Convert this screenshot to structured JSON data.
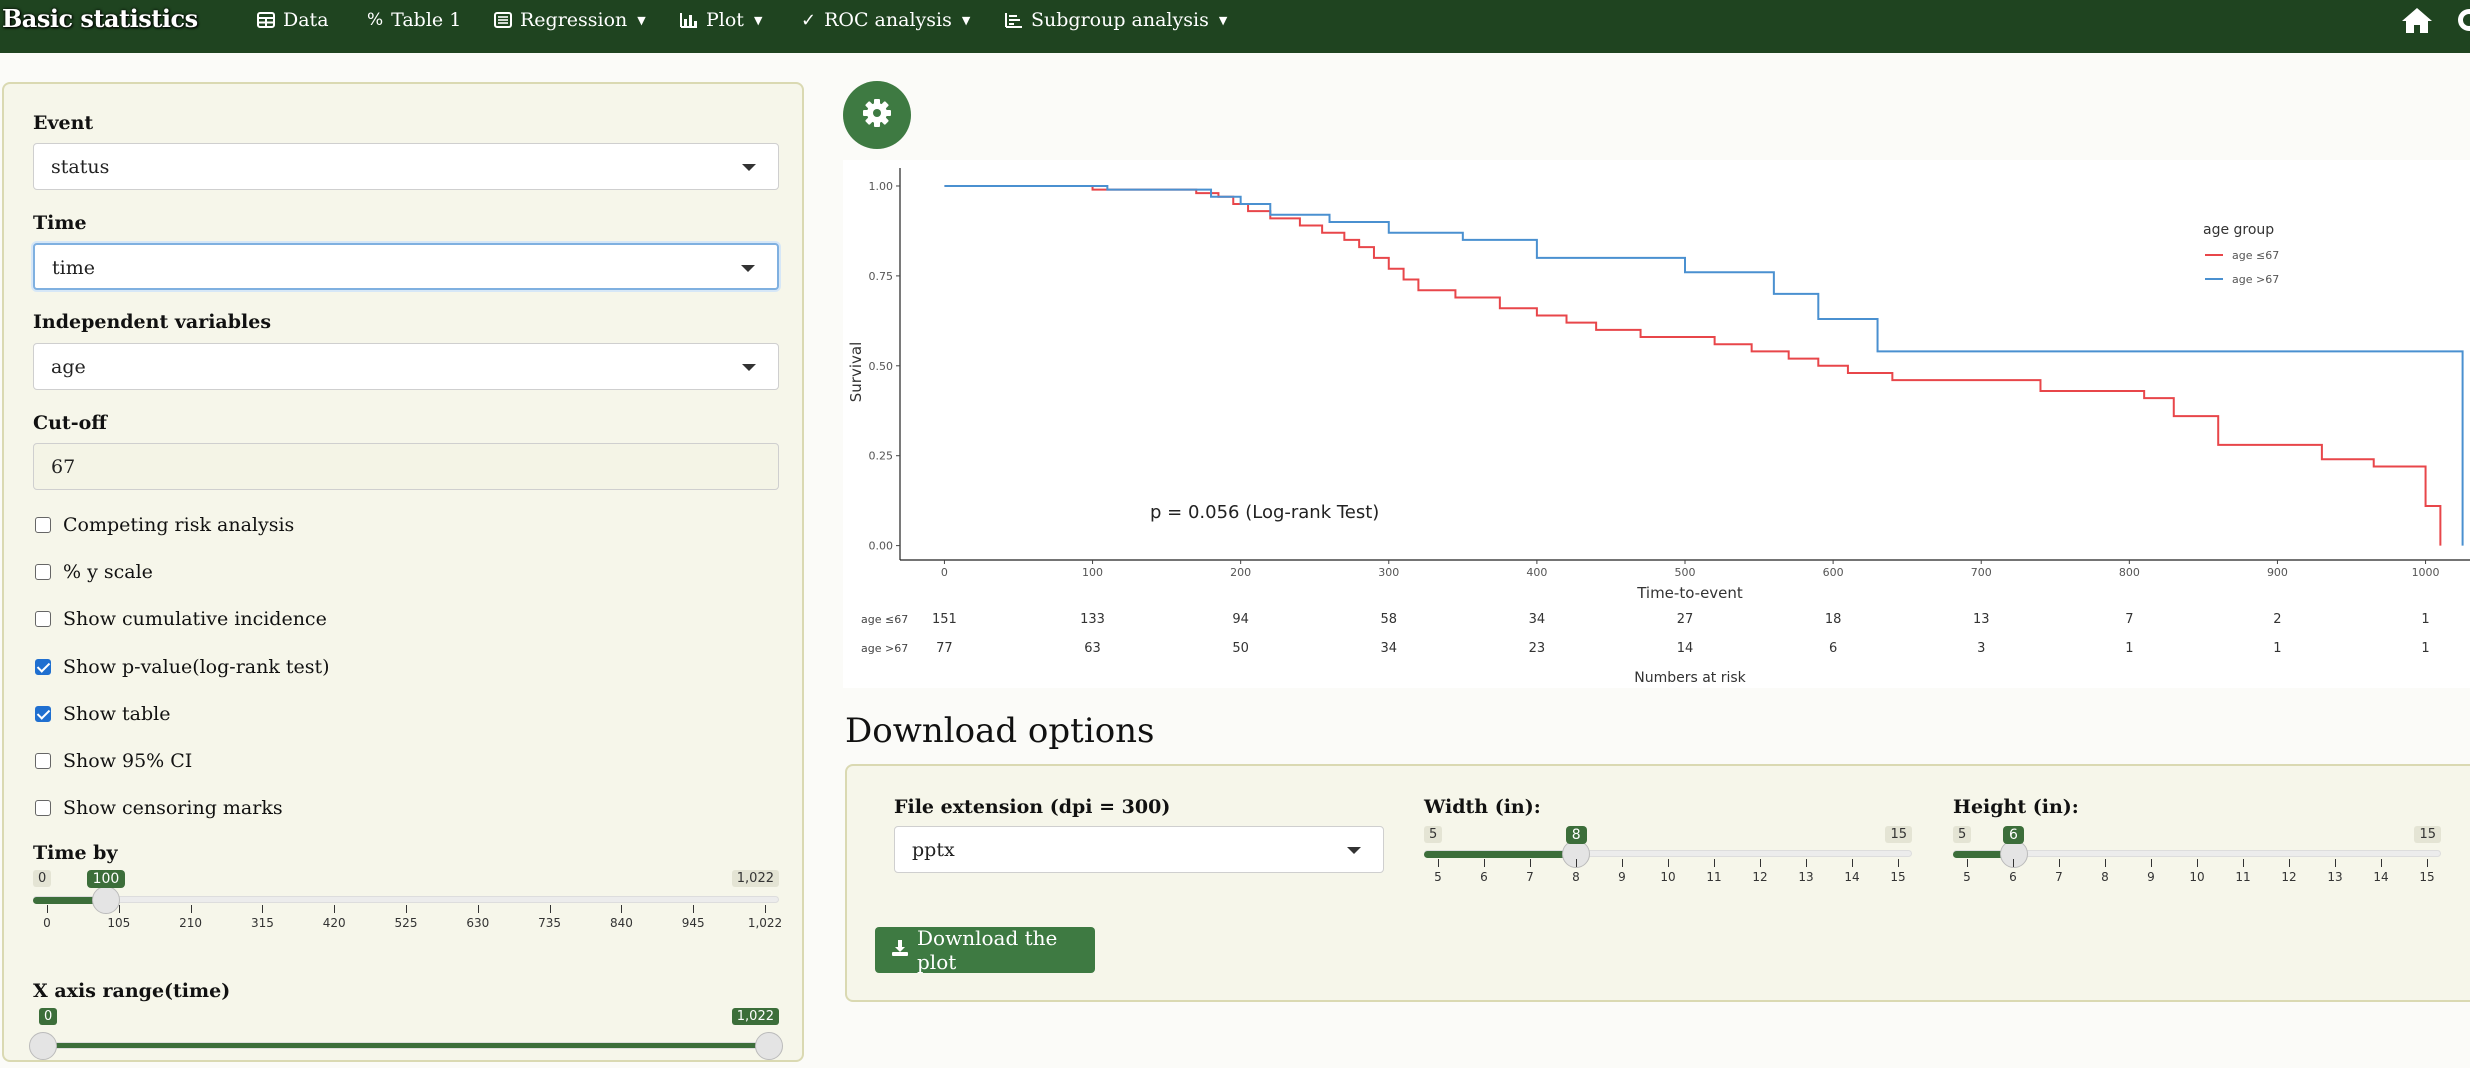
{
  "navbar": {
    "brand": "Basic statistics",
    "items": [
      {
        "label": "Data",
        "icon": "table-icon",
        "dropdown": false
      },
      {
        "label": "Table 1",
        "icon": "percent-icon",
        "dropdown": false
      },
      {
        "label": "Regression",
        "icon": "list-alt-icon",
        "dropdown": true
      },
      {
        "label": "Plot",
        "icon": "bar-chart-icon",
        "dropdown": true
      },
      {
        "label": "ROC analysis",
        "icon": "check-icon",
        "dropdown": true
      },
      {
        "label": "Subgroup analysis",
        "icon": "line-chart-icon",
        "dropdown": true
      }
    ]
  },
  "sidebar": {
    "event": {
      "label": "Event",
      "value": "status"
    },
    "time": {
      "label": "Time",
      "value": "time"
    },
    "indep": {
      "label": "Independent variables",
      "value": "age"
    },
    "cutoff": {
      "label": "Cut-off",
      "value": "67"
    },
    "checkboxes": [
      {
        "label": "Competing risk analysis",
        "checked": false
      },
      {
        "label": "% y scale",
        "checked": false
      },
      {
        "label": "Show cumulative incidence",
        "checked": false
      },
      {
        "label": "Show p-value(log-rank test)",
        "checked": true
      },
      {
        "label": "Show table",
        "checked": true
      },
      {
        "label": "Show 95% CI",
        "checked": false
      },
      {
        "label": "Show censoring marks",
        "checked": false
      }
    ],
    "time_by": {
      "label": "Time by",
      "min": "0",
      "max": "1,022",
      "value": "100",
      "value_fraction": 0.098,
      "ticks": [
        "0",
        "105",
        "210",
        "315",
        "420",
        "525",
        "630",
        "735",
        "840",
        "945",
        "1,022"
      ]
    },
    "x_range": {
      "label": "X axis range(time)",
      "min": "0",
      "max": "1,022"
    }
  },
  "plot": {
    "legend_title": "age group",
    "series_names": [
      "age ≤67",
      "age >67"
    ],
    "series_colors": [
      "#e8464a",
      "#4a90d0"
    ],
    "p_text": "p = 0.056 (Log-rank Test)",
    "risk_title": "Numbers at risk",
    "risk_rows": [
      {
        "label": "age ≤67",
        "values": [
          "151",
          "133",
          "94",
          "58",
          "34",
          "27",
          "18",
          "13",
          "7",
          "2",
          "1"
        ]
      },
      {
        "label": "age >67",
        "values": [
          "77",
          "63",
          "50",
          "34",
          "23",
          "14",
          "6",
          "3",
          "1",
          "1",
          "1"
        ]
      }
    ]
  },
  "chart_data": {
    "type": "line",
    "xlabel": "Time-to-event",
    "ylabel": "Survival",
    "xlim": [
      -30,
      1030
    ],
    "ylim": [
      -0.04,
      1.05
    ],
    "x_ticks": [
      "0",
      "100",
      "200",
      "300",
      "400",
      "500",
      "600",
      "700",
      "800",
      "900",
      "1000"
    ],
    "y_ticks": [
      "0.00",
      "0.25",
      "0.50",
      "0.75",
      "1.00"
    ],
    "legend": "top-right",
    "series": [
      {
        "name": "age ≤67",
        "steps": [
          [
            0,
            1.0
          ],
          [
            100,
            0.99
          ],
          [
            170,
            0.98
          ],
          [
            185,
            0.97
          ],
          [
            195,
            0.95
          ],
          [
            205,
            0.93
          ],
          [
            220,
            0.91
          ],
          [
            240,
            0.89
          ],
          [
            255,
            0.87
          ],
          [
            270,
            0.85
          ],
          [
            280,
            0.83
          ],
          [
            290,
            0.8
          ],
          [
            300,
            0.77
          ],
          [
            310,
            0.74
          ],
          [
            320,
            0.71
          ],
          [
            345,
            0.69
          ],
          [
            375,
            0.66
          ],
          [
            400,
            0.64
          ],
          [
            420,
            0.62
          ],
          [
            440,
            0.6
          ],
          [
            470,
            0.58
          ],
          [
            520,
            0.56
          ],
          [
            545,
            0.54
          ],
          [
            570,
            0.52
          ],
          [
            590,
            0.5
          ],
          [
            610,
            0.48
          ],
          [
            640,
            0.46
          ],
          [
            740,
            0.43
          ],
          [
            810,
            0.41
          ],
          [
            830,
            0.36
          ],
          [
            860,
            0.28
          ],
          [
            930,
            0.24
          ],
          [
            965,
            0.22
          ],
          [
            1000,
            0.11
          ],
          [
            1010,
            0.0
          ]
        ]
      },
      {
        "name": "age >67",
        "steps": [
          [
            0,
            1.0
          ],
          [
            110,
            0.99
          ],
          [
            180,
            0.97
          ],
          [
            200,
            0.95
          ],
          [
            220,
            0.92
          ],
          [
            260,
            0.9
          ],
          [
            300,
            0.87
          ],
          [
            350,
            0.85
          ],
          [
            400,
            0.8
          ],
          [
            500,
            0.76
          ],
          [
            560,
            0.7
          ],
          [
            590,
            0.63
          ],
          [
            630,
            0.54
          ],
          [
            1010,
            0.54
          ],
          [
            1025,
            0.0
          ]
        ]
      }
    ]
  },
  "download": {
    "title": "Download options",
    "ext": {
      "label": "File extension (dpi = 300)",
      "value": "pptx"
    },
    "width": {
      "label": "Width (in):",
      "min": "5",
      "max": "15",
      "value": "8",
      "value_number": 8,
      "ticks": [
        "5",
        "6",
        "7",
        "8",
        "9",
        "10",
        "11",
        "12",
        "13",
        "14",
        "15"
      ]
    },
    "height": {
      "label": "Height (in):",
      "min": "5",
      "max": "15",
      "value": "6",
      "value_number": 6,
      "ticks": [
        "5",
        "6",
        "7",
        "8",
        "9",
        "10",
        "11",
        "12",
        "13",
        "14",
        "15"
      ]
    },
    "button": "Download the plot"
  }
}
